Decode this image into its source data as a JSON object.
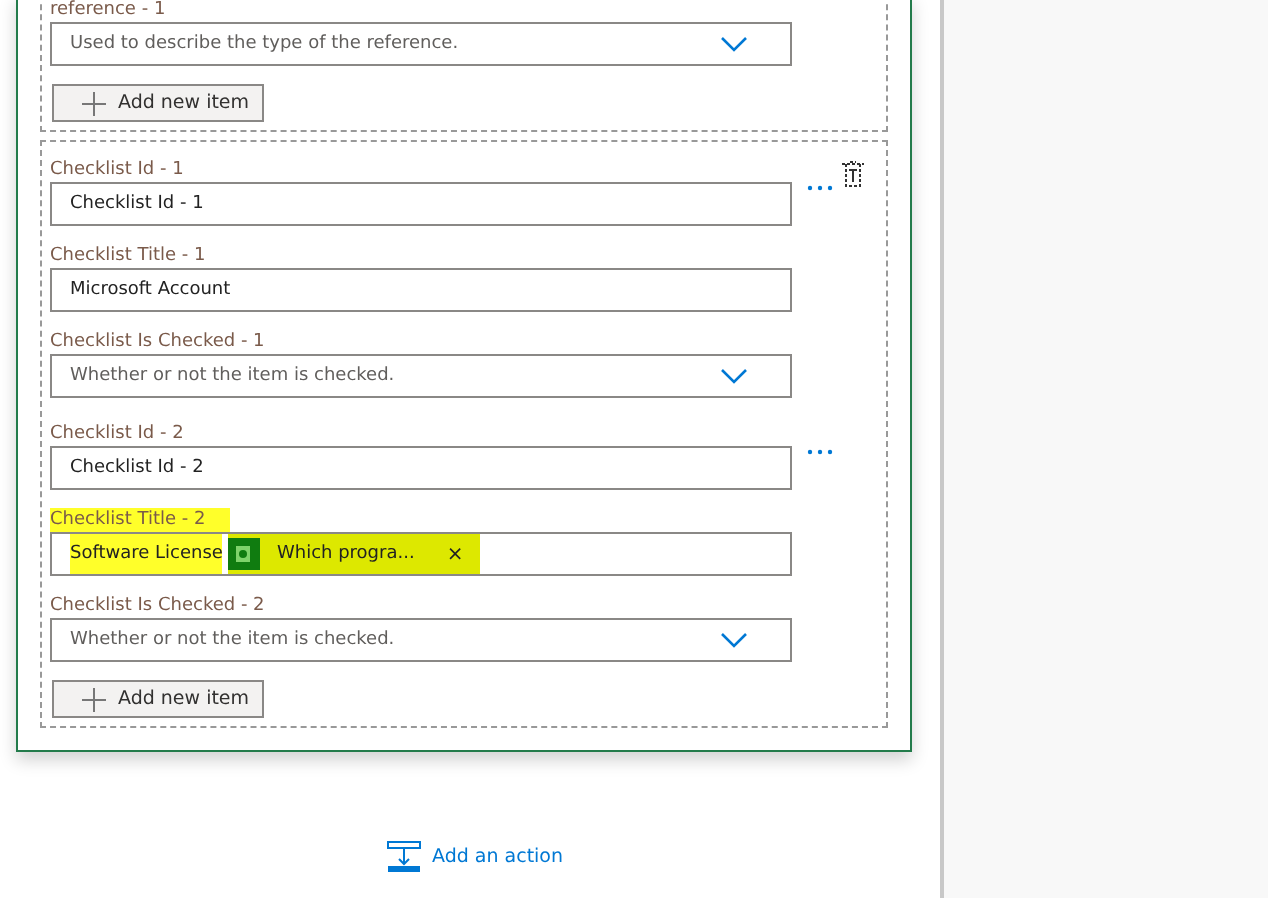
{
  "groups": [
    {
      "delete_icon": false,
      "items": [
        {
          "more_menu": false,
          "fields": [
            {
              "kind": "dropdown",
              "label": "reference - 1",
              "placeholder": "Used to describe the type of the reference."
            }
          ]
        }
      ],
      "add_button": "Add new item"
    },
    {
      "delete_icon": true,
      "items": [
        {
          "more_menu": true,
          "fields": [
            {
              "kind": "text",
              "label": "Checklist Id - 1",
              "value": "Checklist Id - 1"
            },
            {
              "kind": "text",
              "label": "Checklist Title - 1",
              "value": "Microsoft Account"
            },
            {
              "kind": "dropdown",
              "label": "Checklist Is Checked - 1",
              "placeholder": "Whether or not the item is checked."
            }
          ]
        },
        {
          "more_menu": true,
          "fields": [
            {
              "kind": "text",
              "label": "Checklist Id - 2",
              "value": "Checklist Id - 2"
            },
            {
              "kind": "token",
              "label": "Checklist Title - 2",
              "value": "Software License",
              "token": {
                "label": "Which progra...",
                "remove": "×"
              },
              "highlighted": true
            },
            {
              "kind": "dropdown",
              "label": "Checklist Is Checked - 2",
              "placeholder": "Whether or not the item is checked."
            }
          ]
        }
      ],
      "add_button": "Add new item"
    }
  ],
  "add_action": "Add an action"
}
